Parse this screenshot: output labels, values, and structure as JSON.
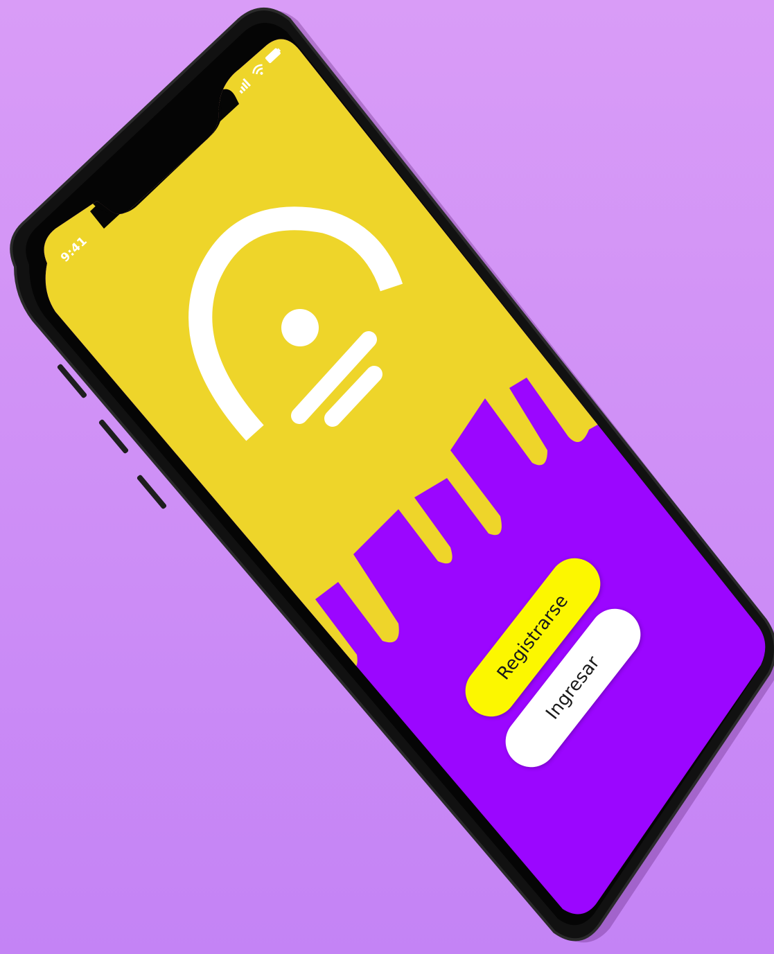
{
  "status_bar": {
    "time": "9:41"
  },
  "buttons": {
    "register_label": "Registrarse",
    "login_label": "Ingresar"
  },
  "colors": {
    "background": "#d39af7",
    "screen_yellow": "#eed52a",
    "screen_purple": "#9b06ff",
    "register_button": "#fcf700",
    "login_button": "#ffffff",
    "phone_frame": "#121212"
  },
  "icons": {
    "logo": "lock-keyhole-logo",
    "signal": "cellular-signal-icon",
    "wifi": "wifi-icon",
    "battery": "battery-icon"
  }
}
